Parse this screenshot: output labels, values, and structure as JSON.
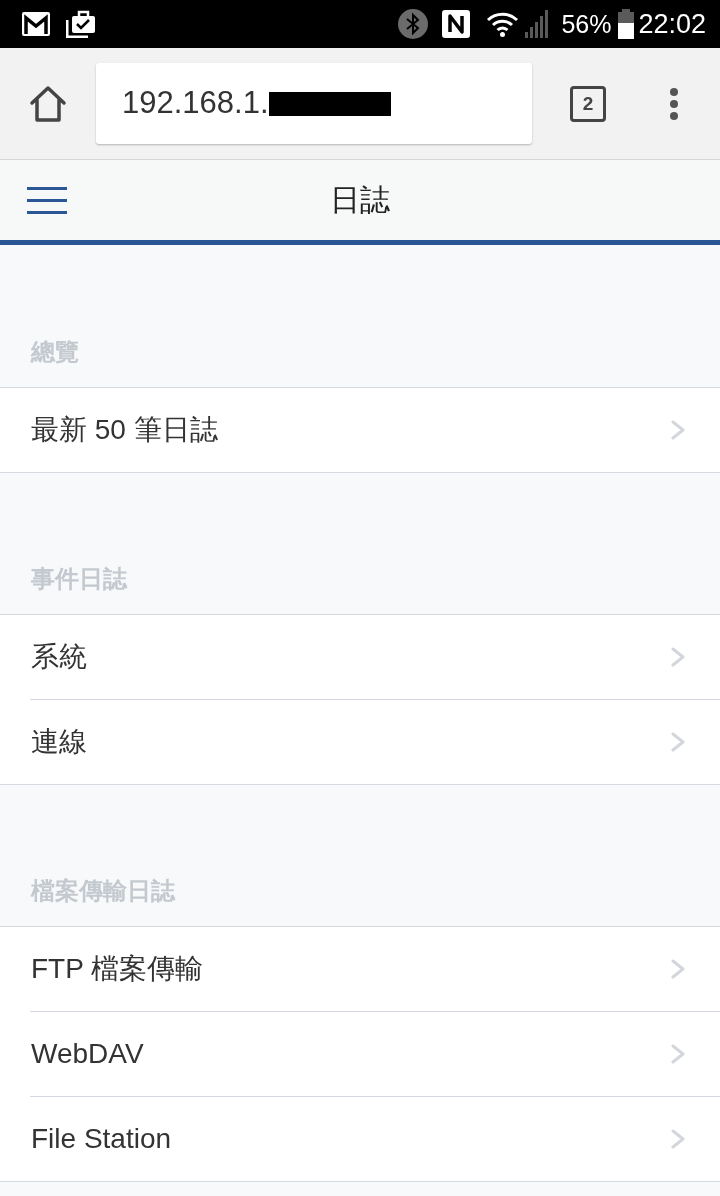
{
  "status_bar": {
    "battery": "56%",
    "time": "22:02"
  },
  "browser": {
    "url": "192.168.1.",
    "tab_count": "2"
  },
  "header": {
    "title": "日誌"
  },
  "sections": [
    {
      "title": "總覽",
      "items": [
        {
          "label": "最新 50 筆日誌"
        }
      ]
    },
    {
      "title": "事件日誌",
      "items": [
        {
          "label": "系統"
        },
        {
          "label": "連線"
        }
      ]
    },
    {
      "title": "檔案傳輸日誌",
      "items": [
        {
          "label": "FTP 檔案傳輸"
        },
        {
          "label": "WebDAV"
        },
        {
          "label": "File Station"
        }
      ]
    }
  ]
}
